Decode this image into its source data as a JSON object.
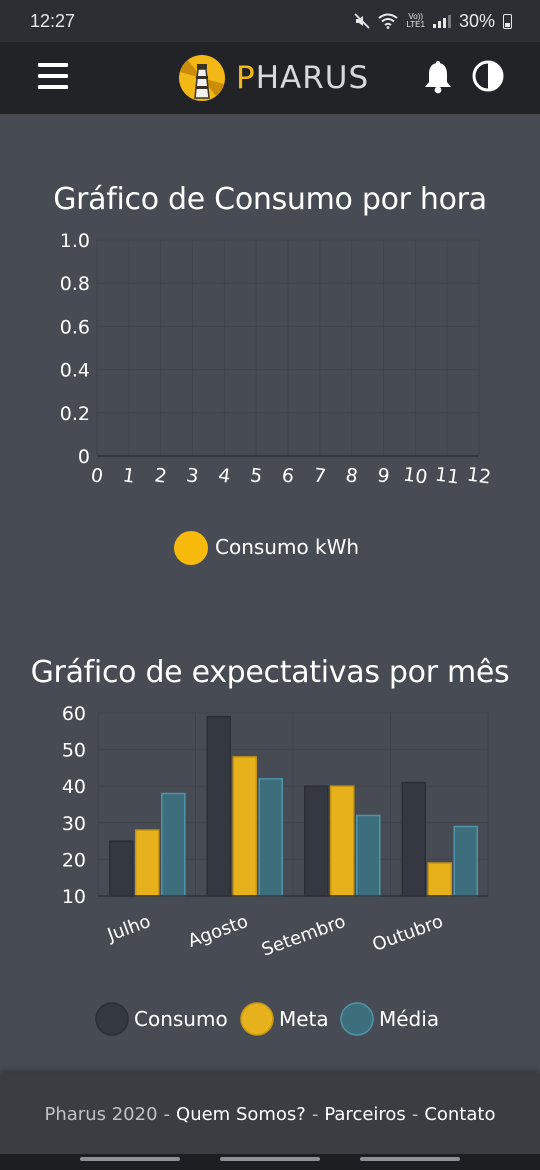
{
  "status_bar": {
    "time": "12:27",
    "lte_top": "Vo))",
    "lte_bottom": "LTE1",
    "battery": "30%"
  },
  "navbar": {
    "brand_first_letter": "P",
    "brand_rest": "HARUS",
    "icons": [
      "menu-icon",
      "lighthouse-logo",
      "bell-icon",
      "contrast-icon"
    ]
  },
  "colors": {
    "consumo": "#343841",
    "meta": "#e6b11b",
    "media": "#3d6e7c",
    "consumo_kwh": "#f8bb0c",
    "background": "#474c54"
  },
  "hourly_chart": {
    "title": "Gráfico de Consumo por hora",
    "legend_label": "Consumo kWh"
  },
  "monthly_chart": {
    "title": "Gráfico de expectativas por mês",
    "legend": [
      "Consumo",
      "Meta",
      "Média"
    ]
  },
  "chart_data": [
    {
      "type": "line",
      "title": "Gráfico de Consumo por hora",
      "x": [
        0,
        1,
        2,
        3,
        4,
        5,
        6,
        7,
        8,
        9,
        10,
        11,
        12
      ],
      "ytick_labels": [
        "0",
        "0.2",
        "0.4",
        "0.6",
        "0.8",
        "1.0"
      ],
      "ylim": [
        0,
        1.0
      ],
      "series": [
        {
          "name": "Consumo kWh",
          "values": []
        }
      ],
      "grid": true,
      "legend_position": "bottom"
    },
    {
      "type": "bar",
      "title": "Gráfico de expectativas por mês",
      "categories": [
        "Julho",
        "Agosto",
        "Setembro",
        "Outubro"
      ],
      "series": [
        {
          "name": "Consumo",
          "values": [
            25,
            59,
            40,
            41
          ]
        },
        {
          "name": "Meta",
          "values": [
            28,
            48,
            40,
            19
          ]
        },
        {
          "name": "Média",
          "values": [
            38,
            42,
            32,
            29
          ]
        }
      ],
      "ytick_labels": [
        "10",
        "20",
        "30",
        "40",
        "50",
        "60"
      ],
      "ylim": [
        10,
        60
      ],
      "grid": true,
      "legend_position": "bottom"
    }
  ],
  "footer": {
    "copyright": "Pharus 2020",
    "separator": "-",
    "links": [
      "Quem Somos?",
      "Parceiros",
      "Contato"
    ]
  }
}
